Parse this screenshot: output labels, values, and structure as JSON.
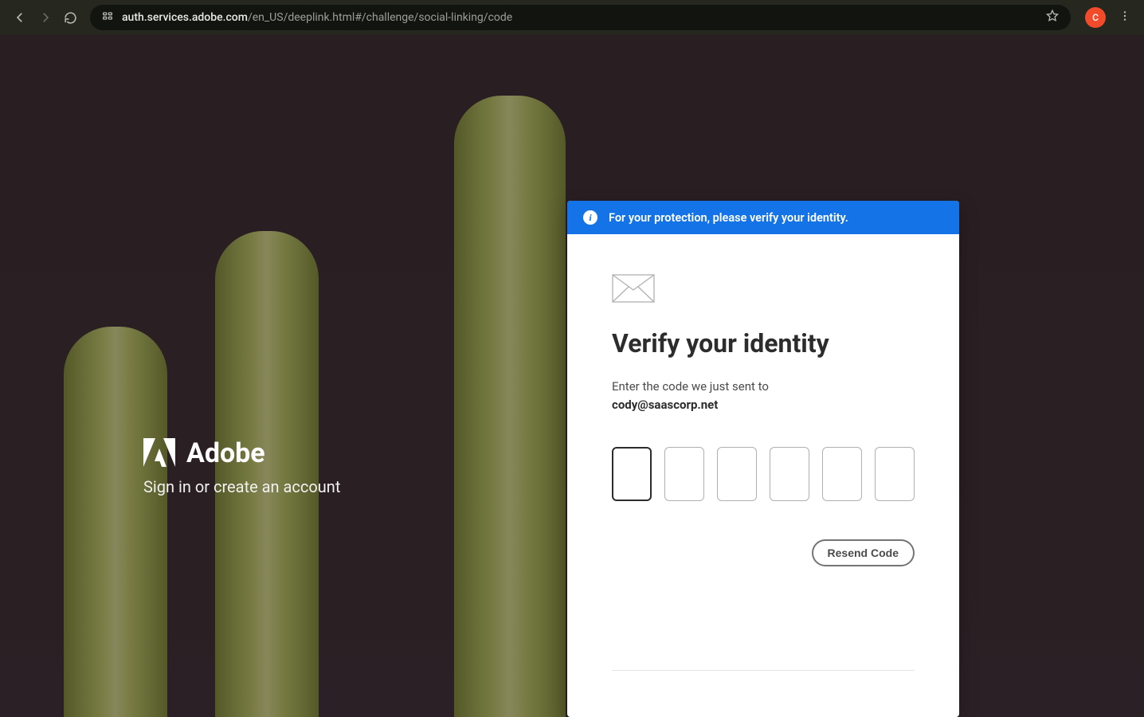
{
  "browser": {
    "url_domain": "auth.services.adobe.com",
    "url_path": "/en_US/deeplink.html#/challenge/social-linking/code",
    "profile_initial": "C"
  },
  "brand": {
    "name": "Adobe",
    "subtitle": "Sign in or create an account"
  },
  "banner": {
    "message": "For your protection, please verify your identity."
  },
  "card": {
    "title": "Verify your identity",
    "instruction": "Enter the code we just sent to",
    "email": "cody@saascorp.net",
    "resend_label": "Resend Code",
    "code_length": 6
  },
  "icons": {
    "info_glyph": "i"
  }
}
